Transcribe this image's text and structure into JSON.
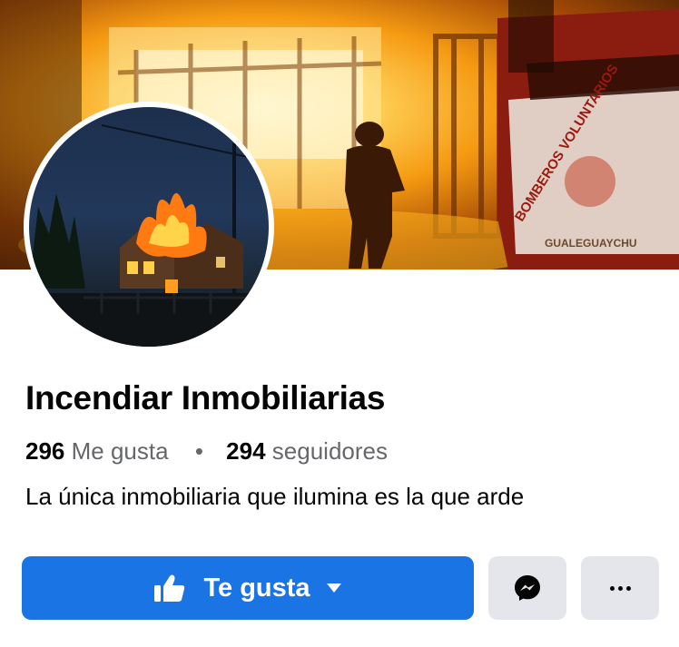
{
  "page": {
    "name": "Incendiar Inmobiliarias",
    "likes_count": "296",
    "likes_label": "Me gusta",
    "separator": "•",
    "followers_count": "294",
    "followers_label": "seguidores",
    "bio": "La única inmobiliaria que ilumina es la que arde"
  },
  "cover": {
    "truck_text": "BOMBEROS VOLUNTARIOS",
    "truck_city": "GUALEGUAYCHU"
  },
  "actions": {
    "like_label": "Te gusta",
    "like_icon": "thumbs-up-icon",
    "message_icon": "messenger-icon",
    "more_icon": "more-icon"
  },
  "colors": {
    "primary": "#1b74e4",
    "secondary_button": "#e4e6eb",
    "text_primary": "#050505",
    "text_secondary": "#65676b"
  }
}
